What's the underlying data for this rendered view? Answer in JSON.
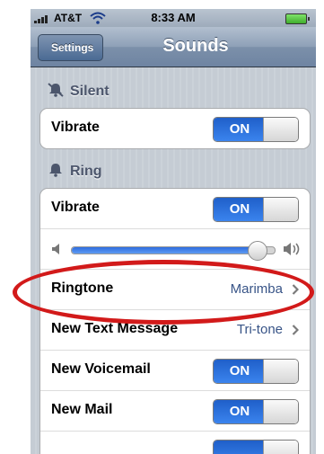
{
  "status_bar": {
    "carrier": "AT&T",
    "time": "8:33 AM",
    "wifi_icon": "wifi-icon",
    "battery_icon": "battery-icon"
  },
  "nav": {
    "back_label": "Settings",
    "title": "Sounds"
  },
  "silent_section": {
    "title": "Silent",
    "icon": "muted-bell-icon"
  },
  "silent_rows": [
    {
      "label": "Vibrate",
      "switch": "ON"
    }
  ],
  "ring_section": {
    "title": "Ring",
    "icon": "bell-icon"
  },
  "ring_rows": [
    {
      "label": "Vibrate",
      "switch": "ON"
    },
    {
      "type": "volume-slider",
      "level": 0.95
    },
    {
      "label": "Ringtone",
      "value": "Marimba"
    },
    {
      "label": "New Text Message",
      "value": "Tri-tone"
    },
    {
      "label": "New Voicemail",
      "switch": "ON"
    },
    {
      "label": "New Mail",
      "switch": "ON"
    }
  ],
  "colors": {
    "accent_blue": "#2f72e0",
    "nav_bar": "#8ea0b7",
    "value_text": "#385487",
    "annotation": "#d21a1a"
  }
}
